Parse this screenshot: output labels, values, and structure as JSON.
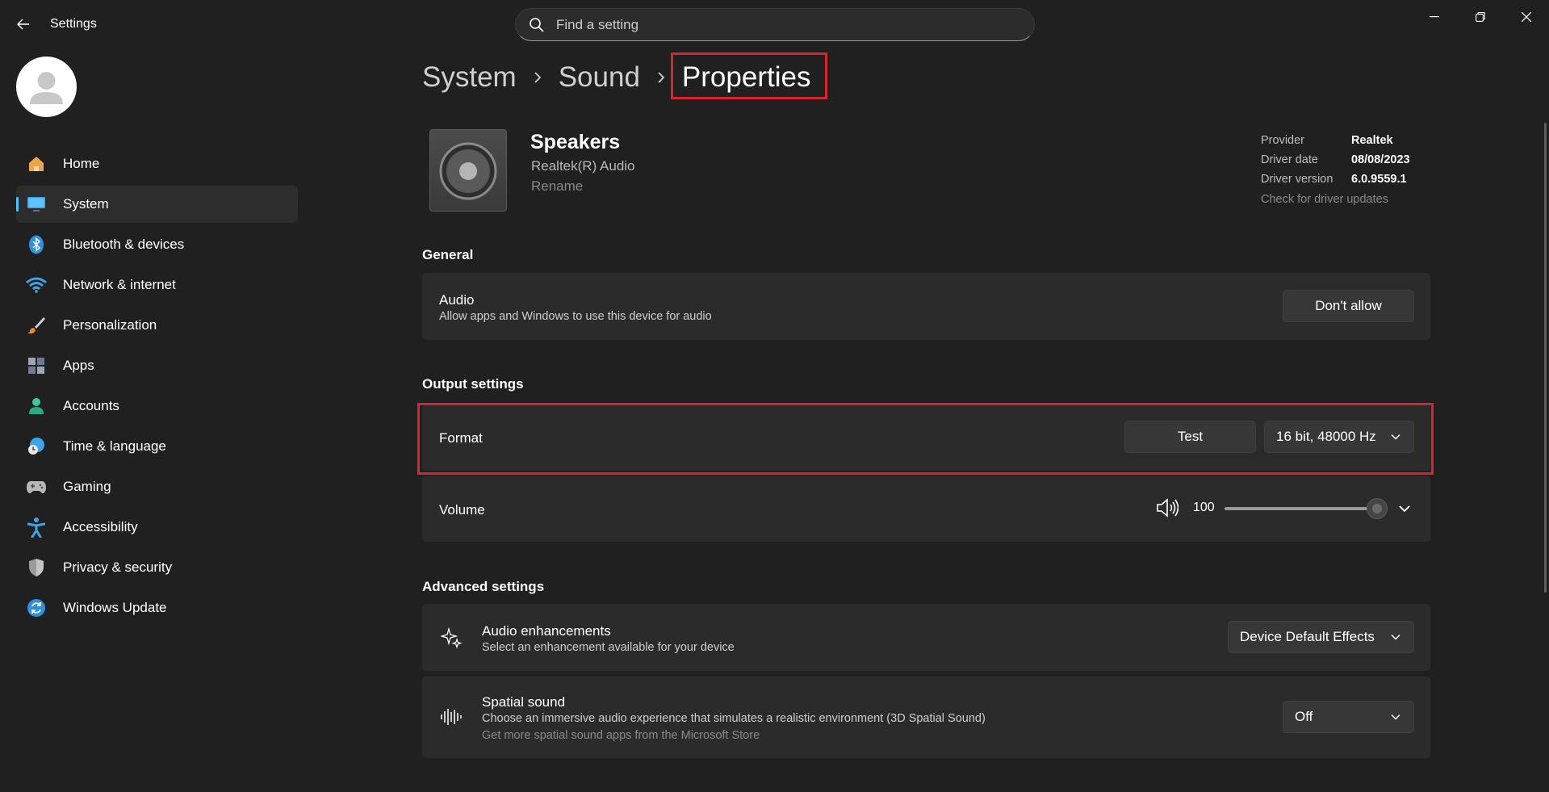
{
  "app": {
    "title": "Settings"
  },
  "search": {
    "placeholder": "Find a setting"
  },
  "sidebar": {
    "items": [
      {
        "label": "Home",
        "icon": "home-icon"
      },
      {
        "label": "System",
        "icon": "system-icon",
        "active": true
      },
      {
        "label": "Bluetooth & devices",
        "icon": "bluetooth-icon"
      },
      {
        "label": "Network & internet",
        "icon": "wifi-icon"
      },
      {
        "label": "Personalization",
        "icon": "brush-icon"
      },
      {
        "label": "Apps",
        "icon": "apps-icon"
      },
      {
        "label": "Accounts",
        "icon": "accounts-icon"
      },
      {
        "label": "Time & language",
        "icon": "globe-clock-icon"
      },
      {
        "label": "Gaming",
        "icon": "gamepad-icon"
      },
      {
        "label": "Accessibility",
        "icon": "accessibility-icon"
      },
      {
        "label": "Privacy & security",
        "icon": "shield-icon"
      },
      {
        "label": "Windows Update",
        "icon": "update-icon"
      }
    ]
  },
  "breadcrumb": {
    "items": [
      "System",
      "Sound",
      "Properties"
    ]
  },
  "device": {
    "name": "Speakers",
    "subtitle": "Realtek(R) Audio",
    "rename": "Rename"
  },
  "driver": {
    "provider_label": "Provider",
    "provider": "Realtek",
    "date_label": "Driver date",
    "date": "08/08/2023",
    "version_label": "Driver version",
    "version": "6.0.9559.1",
    "update_link": "Check for driver updates"
  },
  "general": {
    "title": "General",
    "audio_title": "Audio",
    "audio_desc": "Allow apps and Windows to use this device for audio",
    "audio_button": "Don't allow"
  },
  "output": {
    "title": "Output settings",
    "format_label": "Format",
    "test_button": "Test",
    "format_value": "16 bit, 48000 Hz",
    "volume_label": "Volume",
    "volume_value": "100"
  },
  "advanced": {
    "title": "Advanced settings",
    "enh_title": "Audio enhancements",
    "enh_desc": "Select an enhancement available for your device",
    "enh_value": "Device Default Effects",
    "spatial_title": "Spatial sound",
    "spatial_desc": "Choose an immersive audio experience that simulates a realistic environment (3D Spatial Sound)",
    "spatial_link": "Get more spatial sound apps from the Microsoft Store",
    "spatial_value": "Off"
  },
  "colors": {
    "accent": "#4cc2ff",
    "highlight": "#d9232e",
    "background": "#202020",
    "card": "#2b2b2b"
  }
}
